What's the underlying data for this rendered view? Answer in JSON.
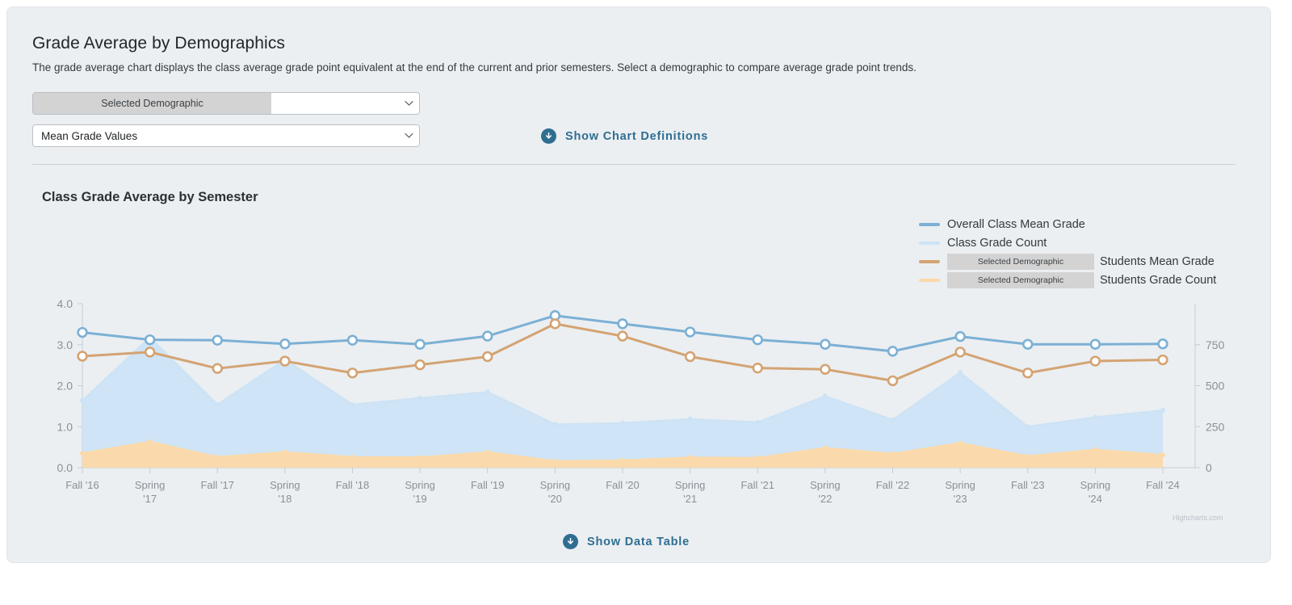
{
  "header": {
    "title": "Grade Average by Demographics",
    "description": "The grade average chart displays the class average grade point equivalent at the end of the current and prior semesters. Select a demographic to compare average grade point trends."
  },
  "controls": {
    "demographic_select": {
      "prefix_label": "Selected Demographic",
      "value": "",
      "placeholder": "",
      "caret_icon": "chevron-down-icon"
    },
    "metric_select": {
      "value": "Mean Grade Values",
      "options": [
        "Mean Grade Values"
      ],
      "caret_icon": "chevron-down-icon"
    },
    "show_chart_definitions": {
      "label": "Show Chart Definitions",
      "icon": "circle-arrow-down-icon"
    },
    "show_data_table": {
      "label": "Show Data Table",
      "icon": "circle-arrow-down-icon"
    }
  },
  "colors": {
    "panel_bg": "#ebeff2",
    "link": "#2f6e91",
    "chip_bg": "#d3d3d3",
    "series_mean_class": "#7cb0d4",
    "series_count_class": "#cde3f5",
    "series_mean_demo": "#d4a373",
    "series_count_demo": "#fcd9a8",
    "axis_text": "#8a9097"
  },
  "credit": "Highcharts.com",
  "chart_data": {
    "type": "line",
    "title": "Class Grade Average by Semester",
    "xlabel": "",
    "ylabel": "",
    "grid": false,
    "legend_position": "top-right",
    "categories": [
      "Fall '16",
      "Spring '17",
      "Fall '17",
      "Spring '18",
      "Fall '18",
      "Spring '19",
      "Fall '19",
      "Spring '20",
      "Fall '20",
      "Spring '21",
      "Fall '21",
      "Spring '22",
      "Fall '22",
      "Spring '23",
      "Fall '23",
      "Spring '24",
      "Fall '24"
    ],
    "y_axis_left": {
      "label": "",
      "min": 0,
      "max": 4,
      "ticks": [
        0.0,
        1.0,
        2.0,
        3.0,
        4.0
      ],
      "tick_labels": [
        "0.0",
        "1.0",
        "2.0",
        "3.0",
        "4.0"
      ]
    },
    "y_axis_right": {
      "label": "",
      "min": 0,
      "max": 1000,
      "ticks": [
        0,
        250,
        500,
        750
      ],
      "tick_labels": [
        "0",
        "250",
        "500",
        "750"
      ]
    },
    "series": [
      {
        "name": "Overall Class Mean Grade",
        "type": "line",
        "axis": "left",
        "color": "#7cb0d4",
        "values": [
          3.3,
          3.12,
          3.11,
          3.02,
          3.11,
          3.01,
          3.21,
          3.71,
          3.51,
          3.31,
          3.12,
          3.01,
          2.84,
          3.2,
          3.01,
          3.01,
          3.02
        ]
      },
      {
        "name": "Class Grade Count",
        "type": "area",
        "axis": "right",
        "color": "#cde3f5",
        "values": [
          410,
          795,
          385,
          660,
          385,
          425,
          462,
          265,
          272,
          297,
          277,
          437,
          292,
          580,
          250,
          308,
          350
        ]
      },
      {
        "name": "Selected Demographic Students Mean Grade",
        "legend_prefix_chip": "Selected Demographic",
        "legend_suffix": "Students Mean Grade",
        "type": "line",
        "axis": "left",
        "color": "#d4a373",
        "values": [
          2.72,
          2.82,
          2.42,
          2.6,
          2.31,
          2.51,
          2.71,
          3.51,
          3.21,
          2.71,
          2.43,
          2.4,
          2.12,
          2.82,
          2.31,
          2.6,
          2.63
        ]
      },
      {
        "name": "Selected Demographic Students Grade Count",
        "legend_prefix_chip": "Selected Demographic",
        "legend_suffix": "Students Grade Count",
        "type": "area",
        "axis": "right",
        "color": "#fcd9a8",
        "values": [
          88,
          158,
          65,
          95,
          65,
          63,
          95,
          40,
          45,
          62,
          60,
          120,
          85,
          150,
          70,
          110,
          78
        ]
      }
    ]
  }
}
